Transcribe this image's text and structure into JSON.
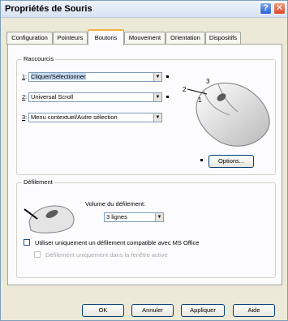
{
  "window": {
    "title": "Propriétés de Souris",
    "help_glyph": "?",
    "close_glyph": "✕"
  },
  "tabs": [
    {
      "label": "Configuration",
      "active": false
    },
    {
      "label": "Pointeurs",
      "active": false
    },
    {
      "label": "Boutons",
      "active": true
    },
    {
      "label": "Mouvement",
      "active": false
    },
    {
      "label": "Orientation",
      "active": false
    },
    {
      "label": "Dispositifs",
      "active": false
    }
  ],
  "shortcuts": {
    "group_label": "Raccourcis",
    "rows": [
      {
        "num": "1",
        "value": "Cliquer/Sélectionner"
      },
      {
        "num": "2",
        "value": "Universal Scroll"
      },
      {
        "num": "3",
        "value": "Menu contextuel/Autre sélection"
      }
    ],
    "mouse_labels": [
      "1",
      "2",
      "3"
    ],
    "options_label": "Options..."
  },
  "scrolling": {
    "group_label": "Défilement",
    "volume_label": "Volume du défilement:",
    "volume_value": "3 lignes",
    "office_label": "Utiliser uniquement un défilement compatible avec MS Office",
    "office_checked": false,
    "active_window_label": "Défilement uniquement dans la fenêtre active",
    "active_window_checked": false
  },
  "footer": {
    "ok": "OK",
    "cancel": "Annuler",
    "apply": "Appliquer",
    "help": "Aide"
  }
}
